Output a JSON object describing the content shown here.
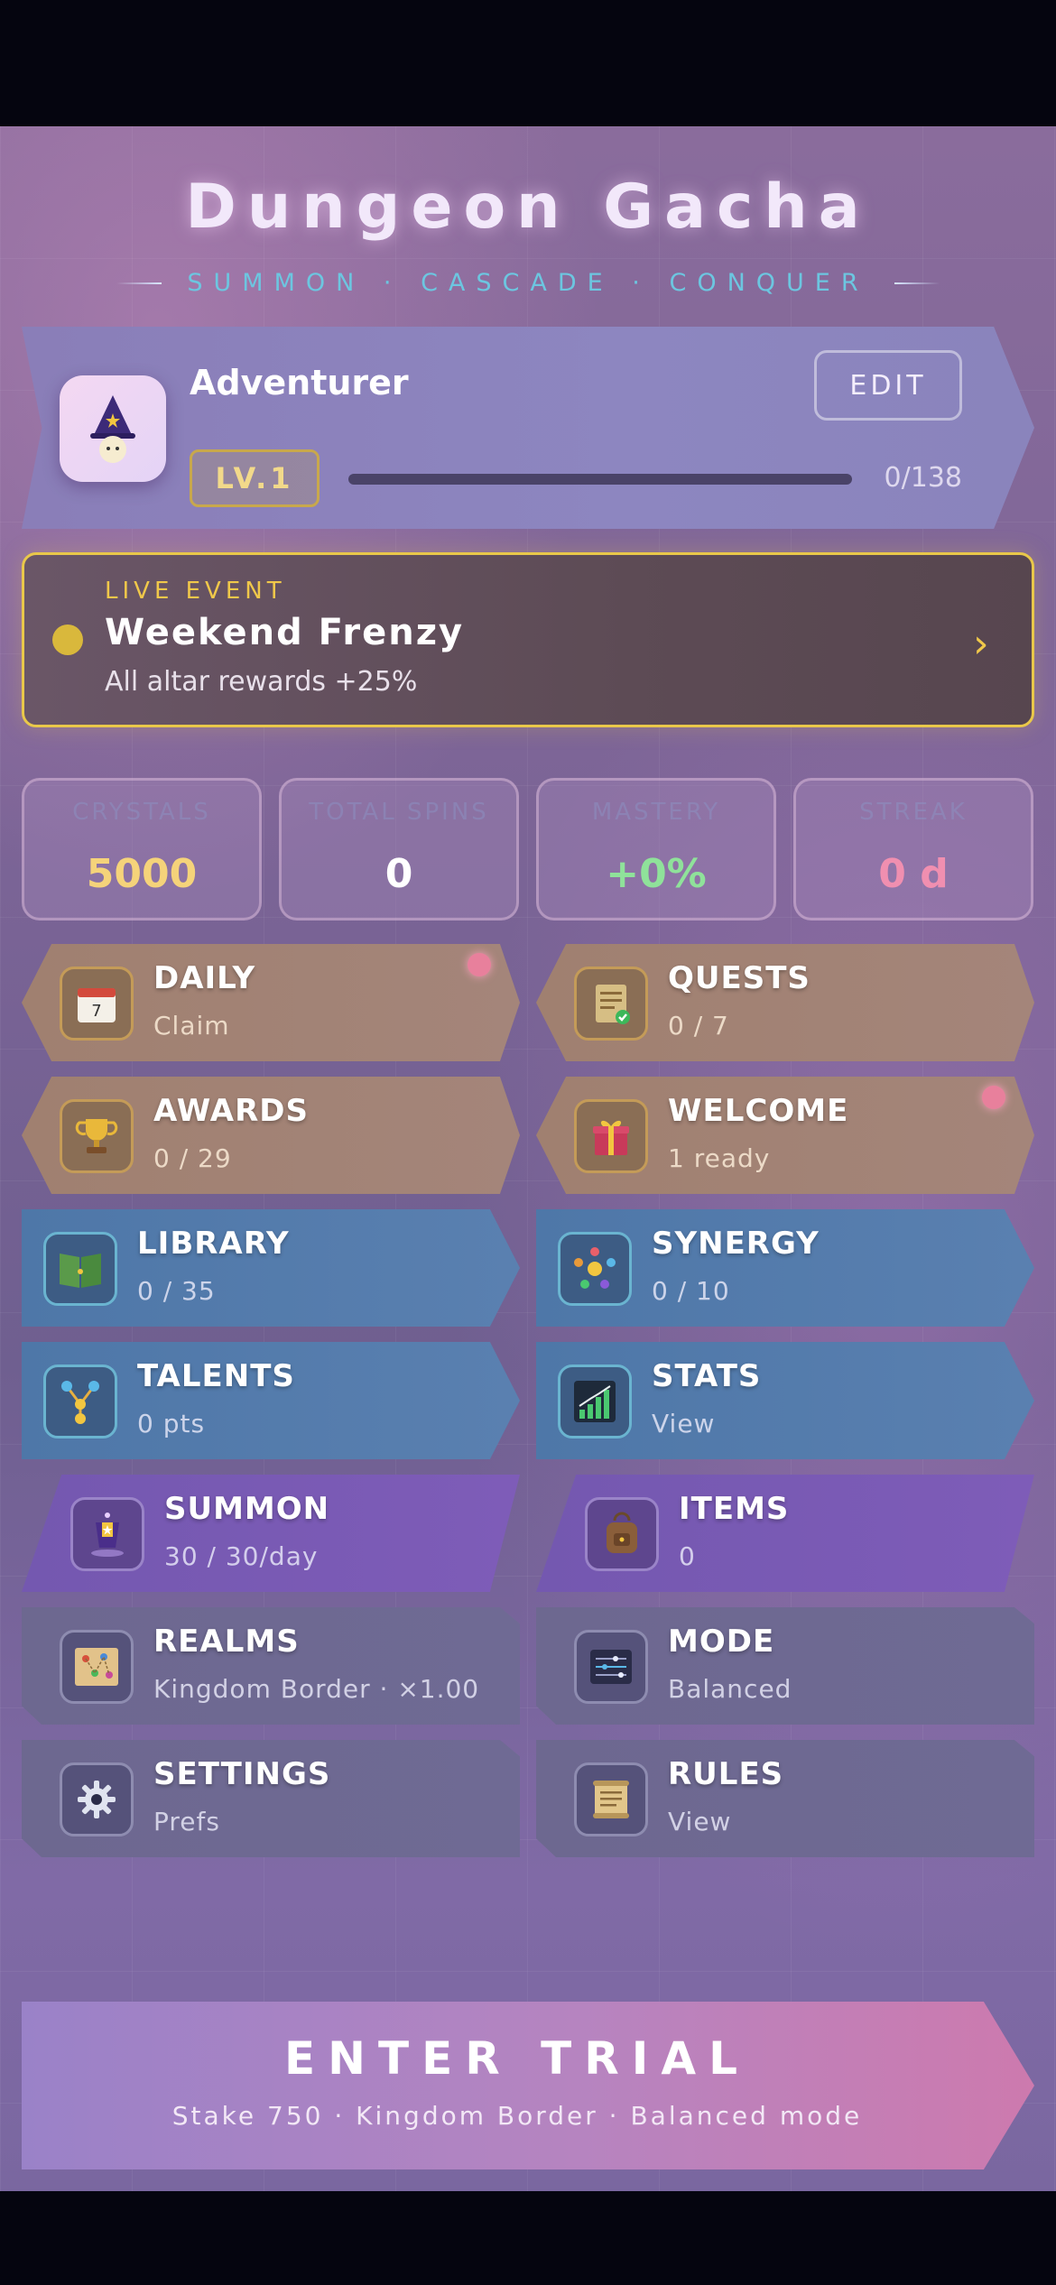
{
  "header": {
    "title": "Dungeon Gacha",
    "subtitle": "SUMMON · CASCADE · CONQUER"
  },
  "profile": {
    "name": "Adventurer",
    "edit_label": "EDIT",
    "level": "LV.1",
    "xp_text": "0/138",
    "xp_fraction": 0,
    "avatar_icon": "wizard-icon"
  },
  "event": {
    "tag": "LIVE EVENT",
    "title": "Weekend Frenzy",
    "description": "All altar rewards +25%",
    "chevron": "›"
  },
  "stats": [
    {
      "label": "CRYSTALS",
      "value": "5000",
      "color": "#f5d37a"
    },
    {
      "label": "TOTAL SPINS",
      "value": "0",
      "color": "#ffffff"
    },
    {
      "label": "MASTERY",
      "value": "+0%",
      "color": "#8fe29a"
    },
    {
      "label": "STREAK",
      "value": "0 d",
      "color": "#f08fb0"
    }
  ],
  "tiles": {
    "daily": {
      "title": "DAILY",
      "sub": "Claim",
      "icon": "calendar-icon",
      "calendar_day": "7"
    },
    "quests": {
      "title": "QUESTS",
      "sub": "0 / 7",
      "icon": "quest-scroll-icon"
    },
    "awards": {
      "title": "AWARDS",
      "sub": "0 / 29",
      "icon": "trophy-icon"
    },
    "welcome": {
      "title": "WELCOME",
      "sub": "1 ready",
      "icon": "gift-icon"
    },
    "library": {
      "title": "LIBRARY",
      "sub": "0 / 35",
      "icon": "book-icon"
    },
    "synergy": {
      "title": "SYNERGY",
      "sub": "0 / 10",
      "icon": "synergy-orbs-icon"
    },
    "talents": {
      "title": "TALENTS",
      "sub": "0 pts",
      "icon": "talent-tree-icon"
    },
    "stats": {
      "title": "STATS",
      "sub": "View",
      "icon": "bar-chart-icon"
    },
    "summon": {
      "title": "SUMMON",
      "sub": "30 / 30/day",
      "icon": "summon-altar-icon"
    },
    "items": {
      "title": "ITEMS",
      "sub": "0",
      "icon": "backpack-icon"
    },
    "realms": {
      "title": "REALMS",
      "sub": "Kingdom Border · ×1.00",
      "icon": "map-icon"
    },
    "mode": {
      "title": "MODE",
      "sub": "Balanced",
      "icon": "sliders-icon"
    },
    "settings": {
      "title": "SETTINGS",
      "sub": "Prefs",
      "icon": "gear-icon"
    },
    "rules": {
      "title": "RULES",
      "sub": "View",
      "icon": "scroll-icon"
    }
  },
  "cta": {
    "title": "ENTER TRIAL",
    "sub": "Stake 750 · Kingdom Border · Balanced mode"
  }
}
